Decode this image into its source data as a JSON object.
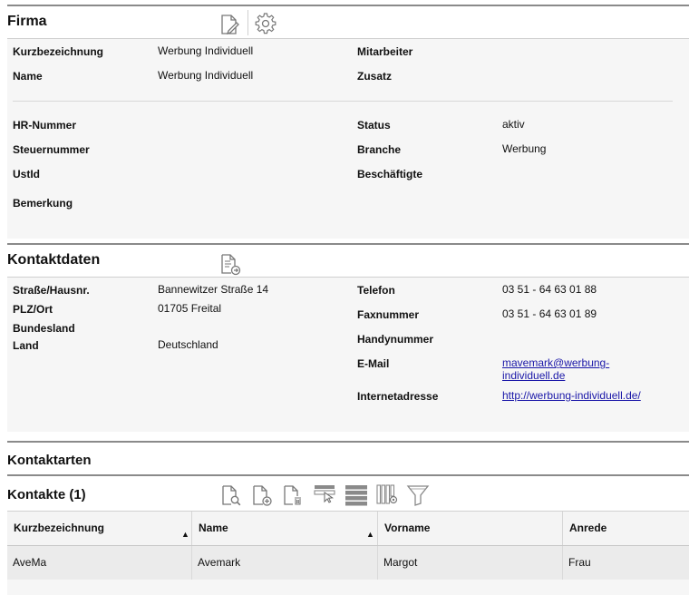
{
  "firma": {
    "title": "Firma",
    "fields": {
      "kurzbezeichnung_label": "Kurzbezeichnung",
      "kurzbezeichnung_value": "Werbung Individuell",
      "name_label": "Name",
      "name_value": "Werbung Individuell",
      "mitarbeiter_label": "Mitarbeiter",
      "zusatz_label": "Zusatz",
      "hr_label": "HR-Nummer",
      "steuer_label": "Steuernummer",
      "ustid_label": "UstId",
      "bemerkung_label": "Bemerkung",
      "status_label": "Status",
      "status_value": "aktiv",
      "branche_label": "Branche",
      "branche_value": "Werbung",
      "beschaeftigte_label": "Beschäftigte"
    }
  },
  "kontaktdaten": {
    "title": "Kontaktdaten",
    "fields": {
      "strasse_label": "Straße/Hausnr.",
      "strasse_value": "Bannewitzer Straße 14",
      "plz_label": "PLZ/Ort",
      "plz_value": "01705 Freital",
      "bundesland_label": "Bundesland",
      "land_label": "Land",
      "land_value": "Deutschland",
      "telefon_label": "Telefon",
      "telefon_value": "03 51 - 64 63 01 88",
      "fax_label": "Faxnummer",
      "fax_value": "03 51 - 64 63 01 89",
      "handy_label": "Handynummer",
      "email_label": "E-Mail",
      "email_line1": "mavemark@werbung-",
      "email_line2": "individuell.de",
      "web_label": "Internetadresse",
      "web_value": "http://werbung-individuell.de/"
    }
  },
  "kontaktarten": {
    "title": "Kontaktarten"
  },
  "kontakte": {
    "title": "Kontakte (1)",
    "columns": [
      "Kurzbezeichnung",
      "Name",
      "Vorname",
      "Anrede"
    ],
    "rows": [
      [
        "AveMa",
        "Avemark",
        "Margot",
        "Frau"
      ]
    ]
  },
  "icons": {
    "firma": [
      "edit-document-icon",
      "gear-icon"
    ],
    "kontaktdaten": [
      "document-export-icon"
    ],
    "kontakte": [
      "search-document-icon",
      "add-document-icon",
      "delete-document-icon",
      "select-row-icon",
      "list-rows-icon",
      "column-settings-icon",
      "filter-icon"
    ]
  },
  "colors": {
    "link": "#1a17a8",
    "section_bg": "#f6f6f6",
    "border": "#8a8a8a"
  }
}
